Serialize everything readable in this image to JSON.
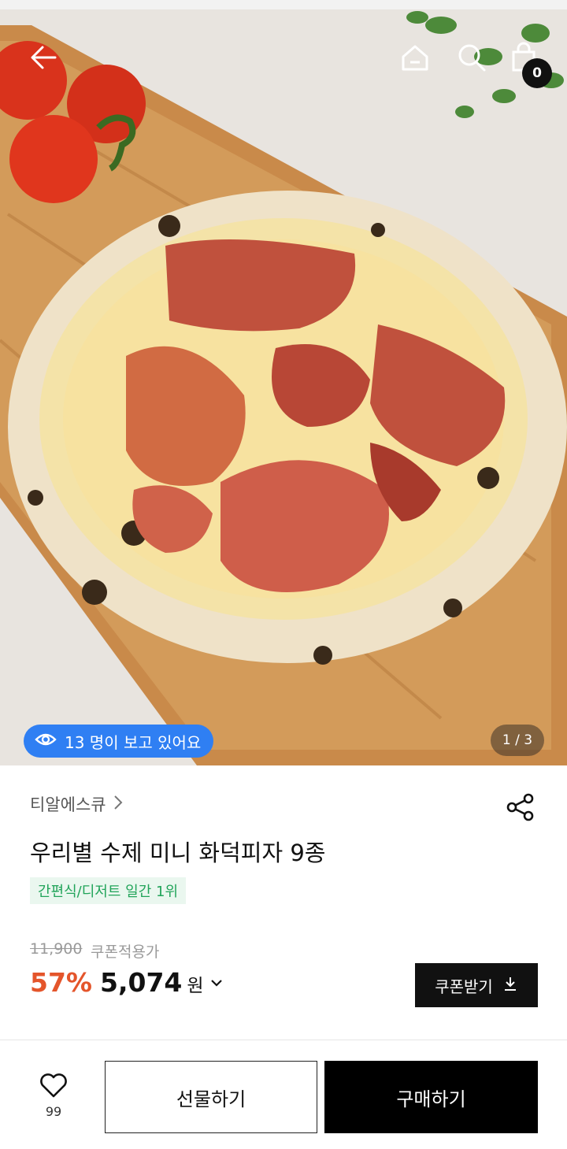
{
  "hero": {
    "viewers_text": "13 명이 보고 있어요",
    "pager": "1 / 3",
    "cart_count": "0"
  },
  "nav": {
    "icons": [
      "back-arrow-icon",
      "home-icon",
      "search-icon",
      "shopping-bag-icon"
    ]
  },
  "product": {
    "brand": "티알에스큐",
    "title": "우리별 수제 미니 화덕피자 9종",
    "rank_tag": "간편식/디저트 일간 1위",
    "original_price": "11,900",
    "coupon_label": "쿠폰적용가",
    "discount": "57%",
    "price": "5,074",
    "currency": "원",
    "coupon_button": "쿠폰받기"
  },
  "bottom_bar": {
    "like_count": "99",
    "gift_button": "선물하기",
    "buy_button": "구매하기"
  },
  "colors": {
    "accent_discount": "#e4552b",
    "viewers_badge": "#2f7ff3",
    "rank_tag_text": "#22a45a",
    "rank_tag_bg": "#eaf7ef"
  }
}
